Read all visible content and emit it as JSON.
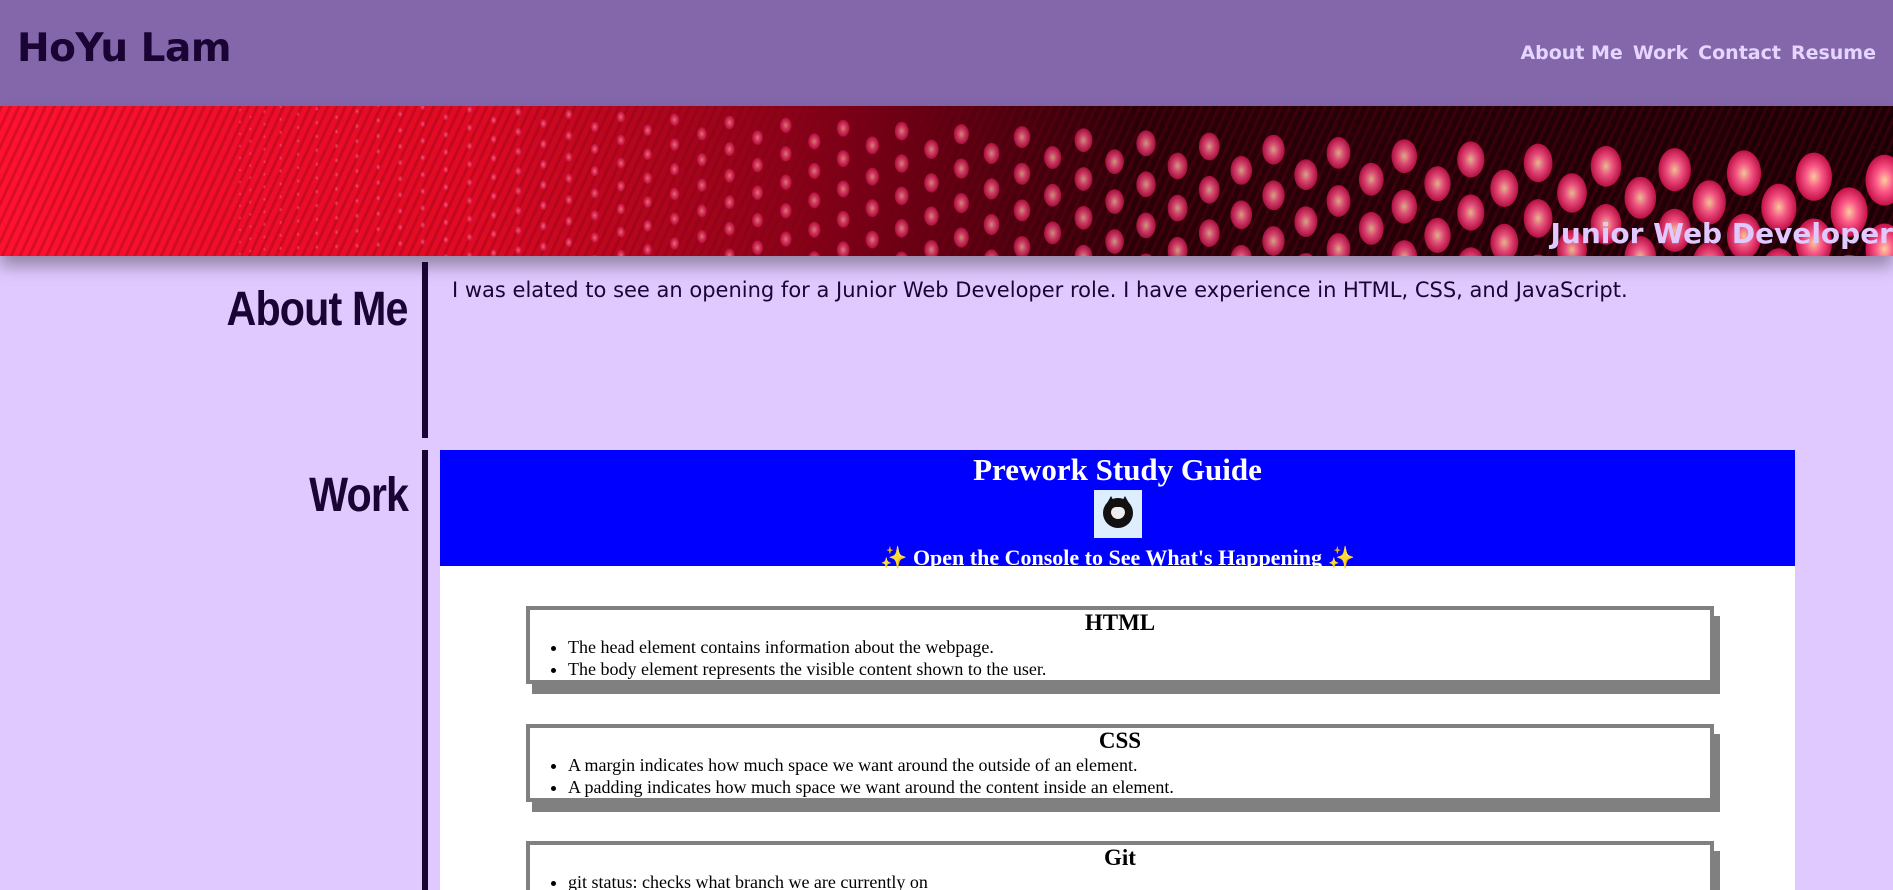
{
  "header": {
    "title": "HoYu Lam",
    "nav": [
      "About Me",
      "Work",
      "Contact",
      "Resume"
    ]
  },
  "hero": {
    "tagline": "Junior Web Developer"
  },
  "about": {
    "heading": "About Me",
    "text": "I was elated to see an opening for a Junior Web Developer role. I have experience in HTML, CSS, and JavaScript."
  },
  "work": {
    "heading": "Work",
    "embed": {
      "title": "Prework Study Guide",
      "subtitle": "✨ Open the Console to See What's Happening ✨",
      "cards": [
        {
          "title": "HTML",
          "items": [
            "The head element contains information about the webpage.",
            "The body element represents the visible content shown to the user."
          ]
        },
        {
          "title": "CSS",
          "items": [
            "A margin indicates how much space we want around the outside of an element.",
            "A padding indicates how much space we want around the content inside an element."
          ]
        },
        {
          "title": "Git",
          "items": [
            "git status: checks what branch we are currently on"
          ]
        }
      ]
    }
  },
  "colors": {
    "header_bg": "#8467ab",
    "page_bg": "#e0c9ff",
    "heading_text": "#1a0433",
    "nav_text": "#e6d5ff",
    "embed_header_bg": "#0000ff"
  }
}
